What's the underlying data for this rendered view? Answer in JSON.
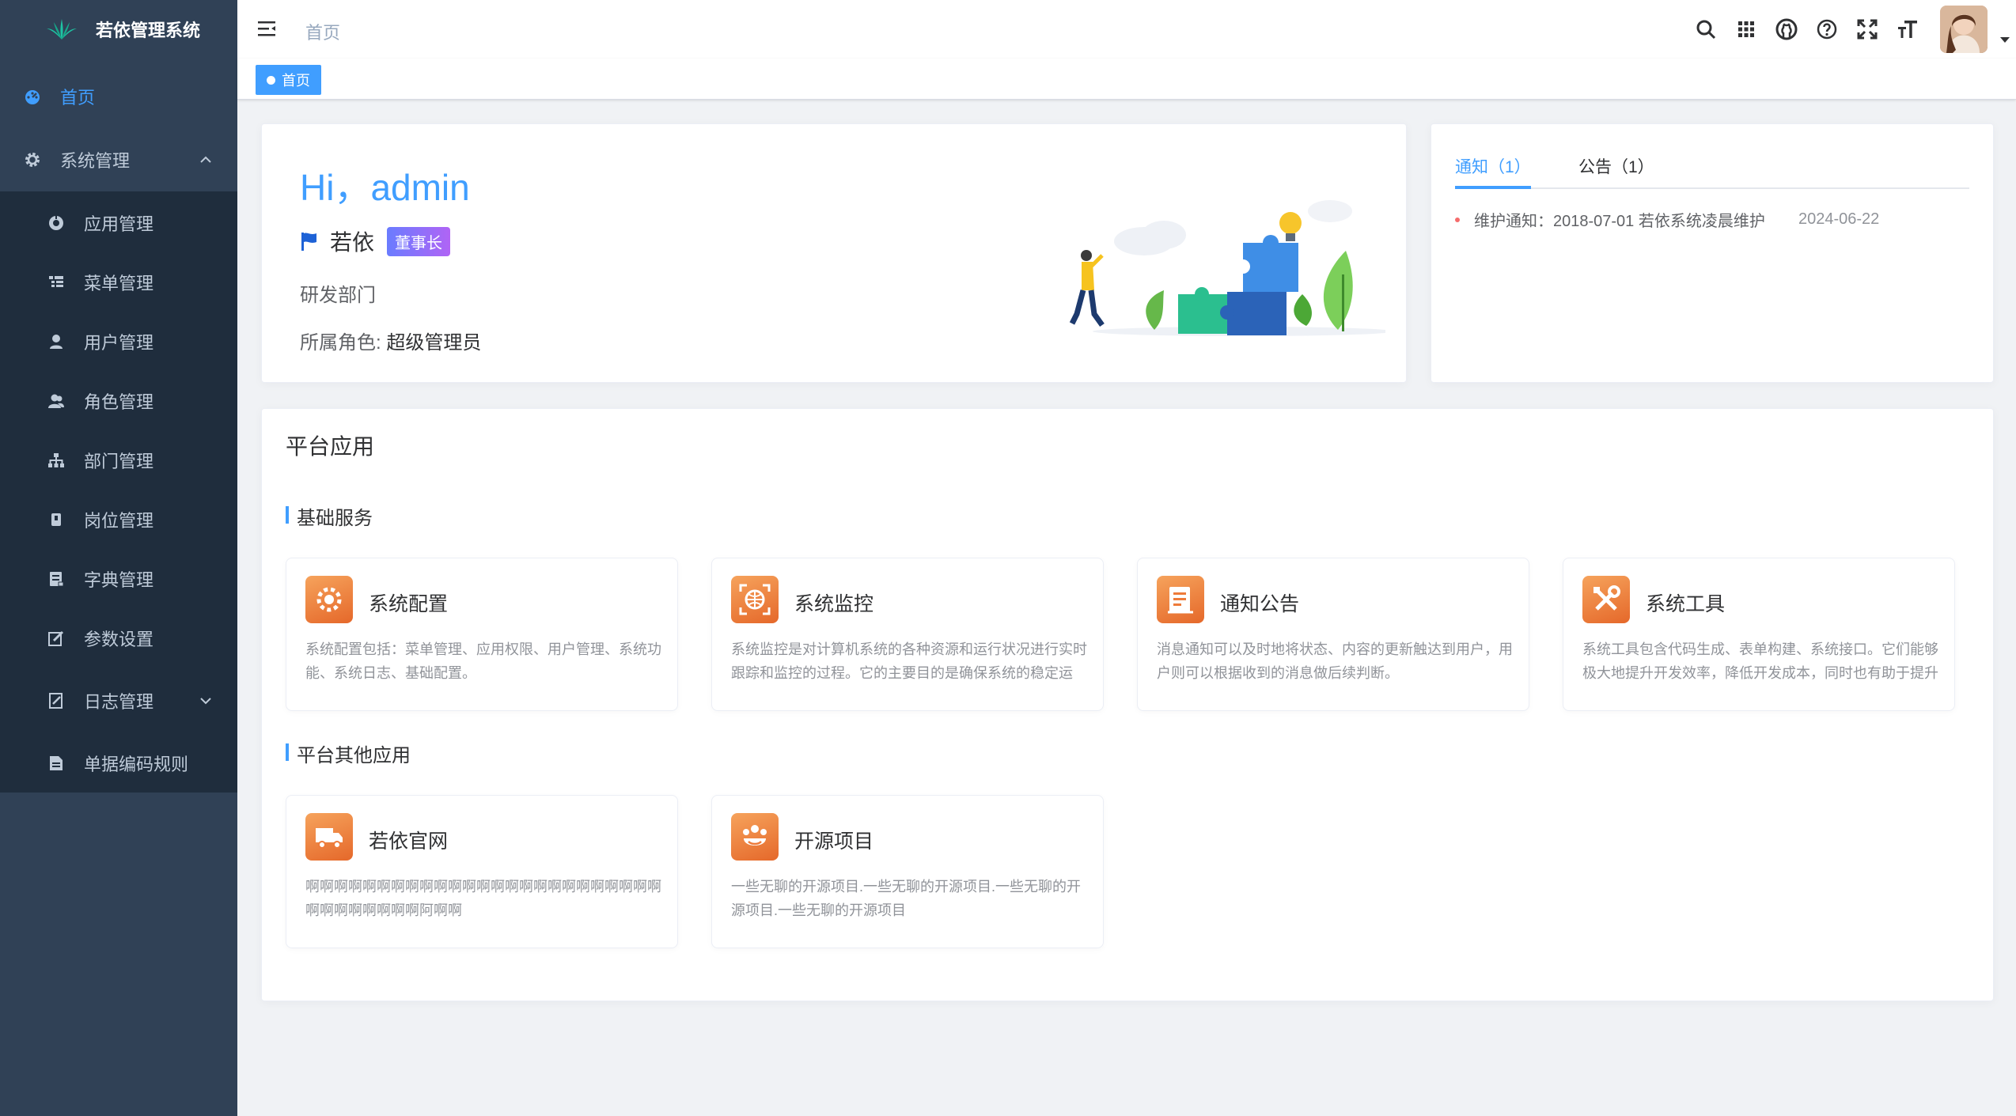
{
  "colors": {
    "sidebar_bg": "#304156",
    "submenu_bg": "#1f2d3d",
    "accent": "#409eff",
    "app_icon": "#ee7b3a"
  },
  "app": {
    "title": "若依管理系统"
  },
  "sidebar": {
    "items": [
      {
        "label": "首页",
        "icon": "dashboard-icon"
      },
      {
        "label": "系统管理",
        "icon": "gear-icon"
      },
      {
        "label": "应用管理",
        "icon": "app-icon"
      },
      {
        "label": "菜单管理",
        "icon": "tree-table-icon"
      },
      {
        "label": "用户管理",
        "icon": "user-icon"
      },
      {
        "label": "角色管理",
        "icon": "peoples-icon"
      },
      {
        "label": "部门管理",
        "icon": "tree-icon"
      },
      {
        "label": "岗位管理",
        "icon": "post-icon"
      },
      {
        "label": "字典管理",
        "icon": "dict-icon"
      },
      {
        "label": "参数设置",
        "icon": "edit-icon"
      },
      {
        "label": "日志管理",
        "icon": "log-icon"
      },
      {
        "label": "单据编码规则",
        "icon": "document-icon"
      }
    ]
  },
  "header": {
    "breadcrumb": "首页",
    "icons": [
      "search-icon",
      "grid-icon",
      "github-icon",
      "question-icon",
      "fullscreen-icon",
      "font-size-icon"
    ]
  },
  "tagsview": {
    "tags": [
      {
        "label": "首页"
      }
    ]
  },
  "welcome": {
    "greeting": "Hi，admin",
    "name": "若依",
    "badge": "董事长",
    "department": "研发部门",
    "role_label": "所属角色:",
    "role_value": "超级管理员"
  },
  "notices": {
    "tabs": [
      {
        "label": "通知（1）"
      },
      {
        "label": "公告（1）"
      }
    ],
    "items": [
      {
        "title": "维护通知：2018-07-01 若依系统凌晨维护",
        "date": "2024-06-22"
      }
    ]
  },
  "apps": {
    "title": "平台应用",
    "sections": [
      {
        "title": "基础服务",
        "items": [
          {
            "name": "系统配置",
            "icon": "config-icon",
            "desc": "系统配置包括：菜单管理、应用权限、用户管理、系统功能、系统日志、基础配置。"
          },
          {
            "name": "系统监控",
            "icon": "monitor-icon",
            "desc": "系统监控是对计算机系统的各种资源和运行状况进行实时跟踪和监控的过程。它的主要目的是确保系统的稳定运行。"
          },
          {
            "name": "通知公告",
            "icon": "notice-icon",
            "desc": "消息通知可以及时地将状态、内容的更新触达到用户，用户则可以根据收到的消息做后续判断。"
          },
          {
            "name": "系统工具",
            "icon": "tools-icon",
            "desc": "系统工具包含代码生成、表单构建、系统接口。它们能够极大地提升开发效率，降低开发成本，同时也有助于提升质量。"
          }
        ]
      },
      {
        "title": "平台其他应用",
        "items": [
          {
            "name": "若依官网",
            "icon": "truck-icon",
            "desc": "啊啊啊啊啊啊啊啊啊啊啊啊啊啊啊啊啊啊啊啊啊啊啊啊啊啊啊啊啊啊啊啊啊阿啊啊"
          },
          {
            "name": "开源项目",
            "icon": "team-icon",
            "desc": "一些无聊的开源项目.一些无聊的开源项目.一些无聊的开源项目.一些无聊的开源项目"
          }
        ]
      }
    ]
  }
}
